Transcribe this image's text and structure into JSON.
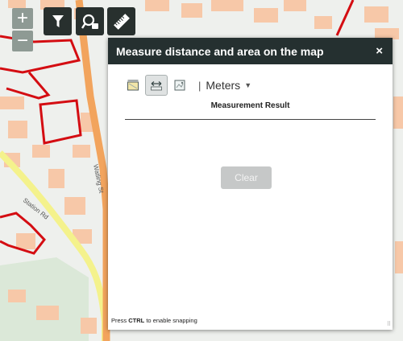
{
  "map": {
    "zoom_in_label": "+",
    "zoom_out_label": "−",
    "street_label_1": "Station Rd",
    "street_label_2": "Watling St",
    "colors": {
      "background": "#eef0ed",
      "building": "#f7c8a8",
      "main_road": "#f2a45d",
      "secondary_road": "#f4f28c",
      "parcel_outline": "#d40d12",
      "park": "#dbe8d8"
    }
  },
  "toolbar": {
    "icons": [
      "filter-icon",
      "search-location-icon",
      "ruler-icon"
    ]
  },
  "panel": {
    "title": "Measure distance and area on the map",
    "close_label": "×",
    "tools": [
      "area-tool-icon",
      "distance-tool-icon",
      "location-tool-icon"
    ],
    "separator": "|",
    "unit": "Meters",
    "result_label": "Measurement Result",
    "clear_label": "Clear",
    "hint_prefix": "Press ",
    "hint_key": "CTRL",
    "hint_suffix": " to enable snapping",
    "colors": {
      "header": "#253030",
      "clear_button": "#c6c8c8"
    }
  }
}
